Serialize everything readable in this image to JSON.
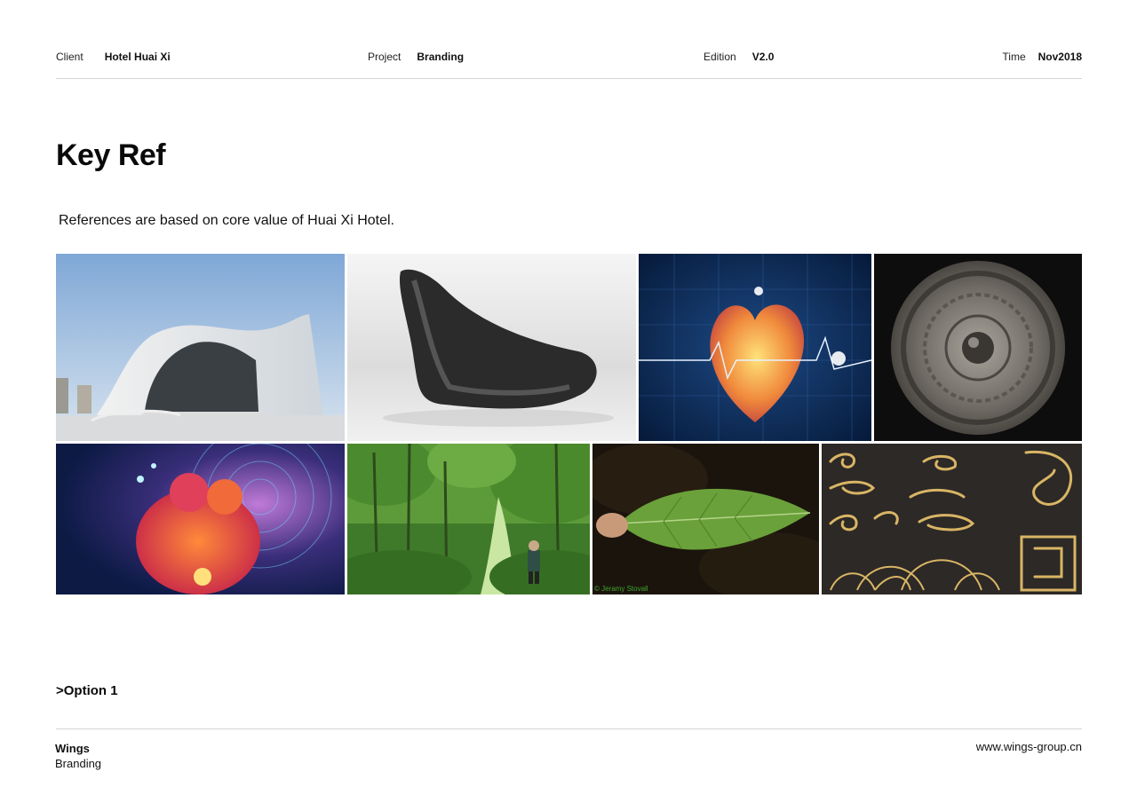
{
  "header": {
    "client_label": "Client",
    "client_value": "Hotel Huai Xi",
    "project_label": "Project",
    "project_value": "Branding",
    "edition_label": "Edition",
    "edition_value": "V2.0",
    "time_label": "Time",
    "time_value": "Nov2018"
  },
  "main": {
    "title": "Key Ref",
    "subtitle": "References are based on core value of Huai Xi Hotel.",
    "images": [
      {
        "subject": "white curved modern building"
      },
      {
        "subject": "black sculptural chair"
      },
      {
        "subject": "glowing heart with pulse line"
      },
      {
        "subject": "ancient bronze mirror"
      },
      {
        "subject": "psychedelic embracing figures"
      },
      {
        "subject": "forest path with hiker"
      },
      {
        "subject": "green leaf in hand",
        "caption": "© Jeramy Stovall"
      },
      {
        "subject": "gold chinese cloud patterns"
      }
    ],
    "option": ">Option 1"
  },
  "footer": {
    "brand": "Wings",
    "brand_sub": "Branding",
    "website": "www.wings-group.cn"
  }
}
